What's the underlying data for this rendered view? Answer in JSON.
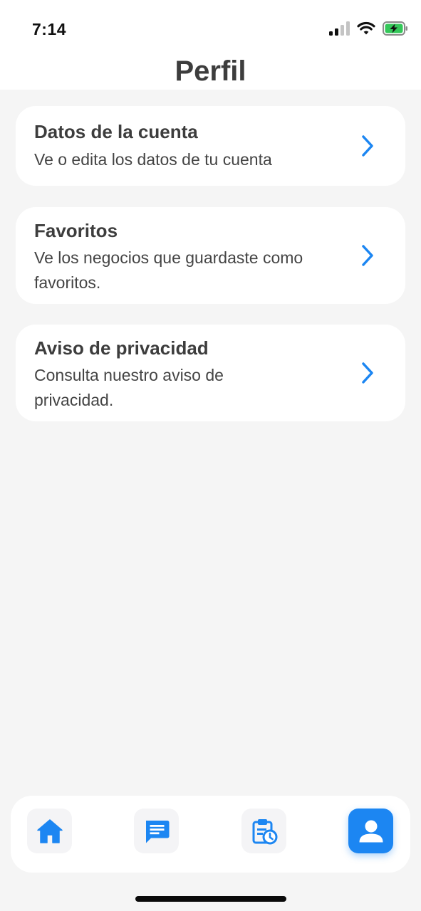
{
  "status_bar": {
    "time": "7:14"
  },
  "header": {
    "title": "Perfil"
  },
  "menu": {
    "items": [
      {
        "title": "Datos de la cuenta",
        "description_lines": [
          "Ve o edita los datos de tu cuenta"
        ]
      },
      {
        "title": "Favoritos",
        "description_lines": [
          "Ve los negocios que guardaste como",
          "favoritos."
        ]
      },
      {
        "title": "Aviso de privacidad",
        "description_lines": [
          "Consulta nuestro aviso de",
          "privacidad."
        ]
      }
    ]
  },
  "bottom_nav": {
    "items": [
      {
        "icon": "home-icon",
        "active": false
      },
      {
        "icon": "chat-icon",
        "active": false
      },
      {
        "icon": "calendar-clock-icon",
        "active": false
      },
      {
        "icon": "user-icon",
        "active": true
      }
    ]
  },
  "colors": {
    "accent": "#1c86f2",
    "background": "#f5f5f5",
    "card": "#ffffff",
    "text": "#3d3d3d",
    "battery_green": "#34c759"
  }
}
